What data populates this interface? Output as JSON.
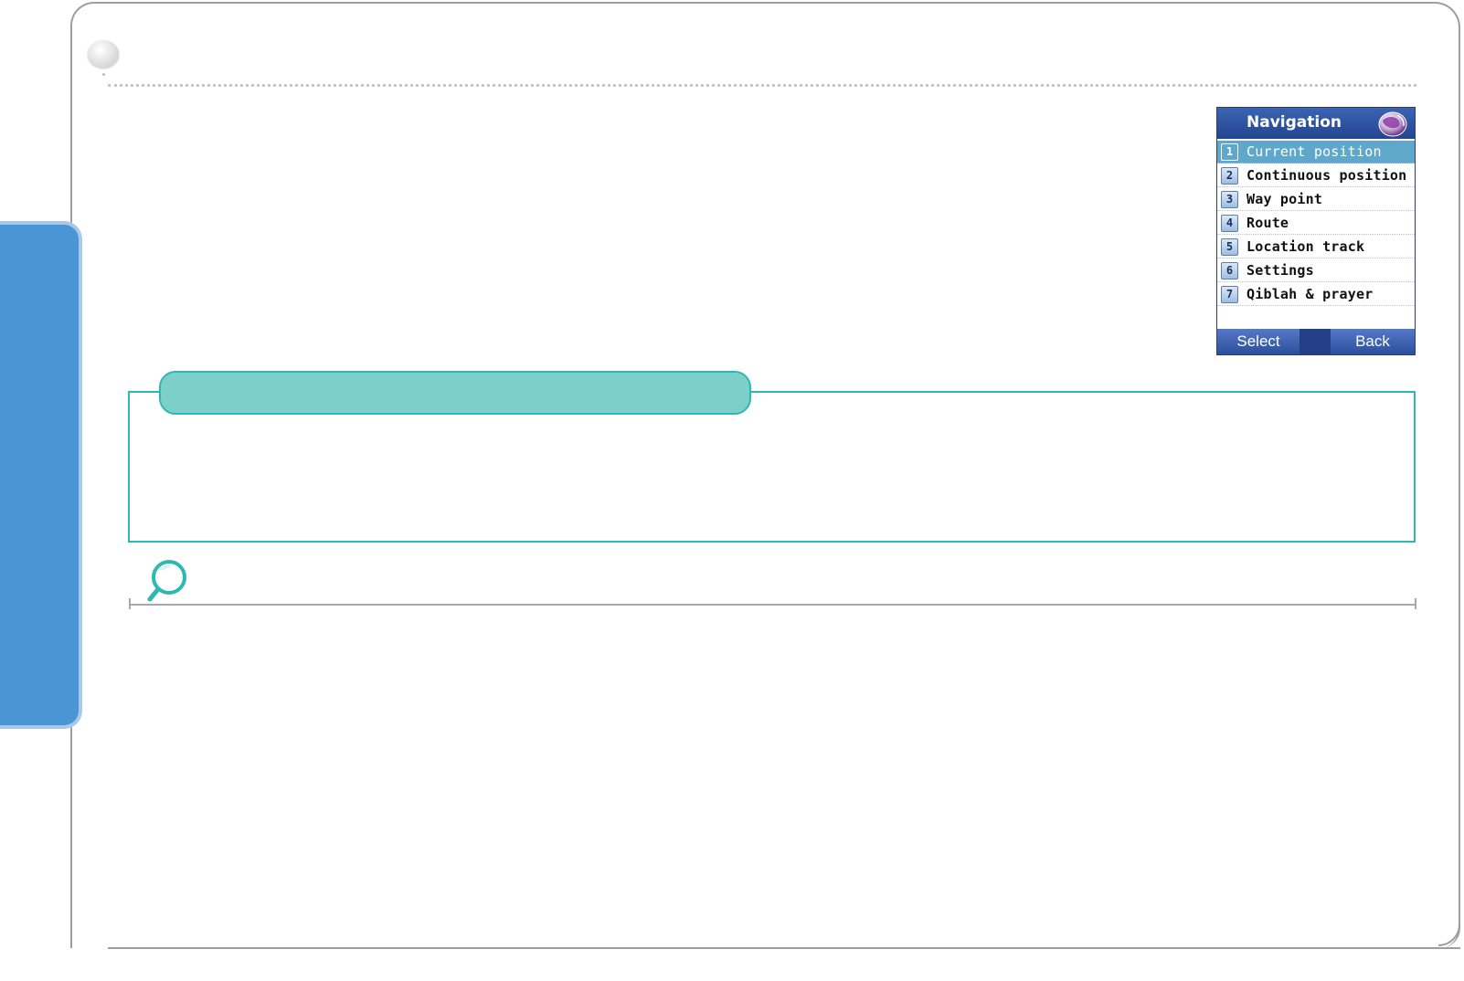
{
  "phone": {
    "title": "Navigation",
    "header_icon": "globe-icon",
    "menu": [
      {
        "num": "1",
        "label": "Current position",
        "selected": true
      },
      {
        "num": "2",
        "label": "Continuous position",
        "selected": false
      },
      {
        "num": "3",
        "label": "Way point",
        "selected": false
      },
      {
        "num": "4",
        "label": "Route",
        "selected": false
      },
      {
        "num": "5",
        "label": "Location track",
        "selected": false
      },
      {
        "num": "6",
        "label": "Settings",
        "selected": false
      },
      {
        "num": "7",
        "label": "Qiblah & prayer",
        "selected": false
      }
    ],
    "softkeys": {
      "left": "Select",
      "right": "Back"
    }
  },
  "colors": {
    "side_tab": "#4a95d3",
    "note_accent": "#2fb7b3",
    "note_tab_fill": "#7dcfcc",
    "phone_header": "#23458f",
    "phone_selected_row": "#5fa8cc"
  },
  "icons": {
    "title_bullet": "bullet-icon",
    "tip": "magnifier-icon"
  }
}
